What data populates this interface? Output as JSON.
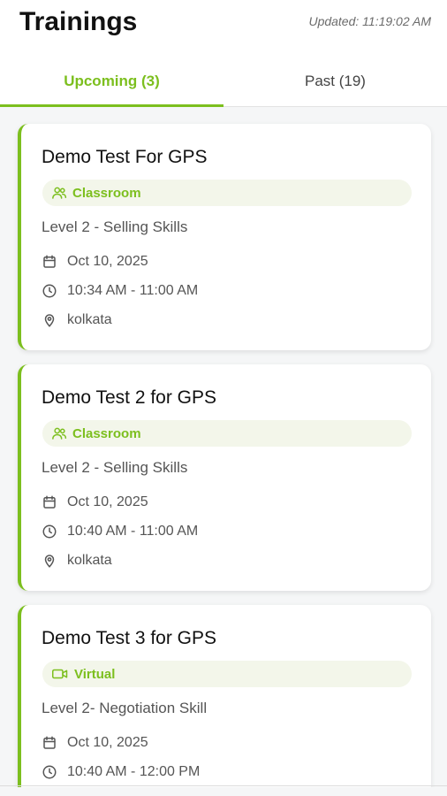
{
  "header": {
    "title": "Trainings",
    "updated": "Updated: 11:19:02 AM"
  },
  "tabs": [
    {
      "label": "Upcoming (3)",
      "active": true
    },
    {
      "label": "Past (19)",
      "active": false
    }
  ],
  "colors": {
    "accent": "#7cbf1e",
    "chip_bg": "#f3f6ea",
    "text_muted": "#555555"
  },
  "trainings": [
    {
      "title": "Demo Test For GPS",
      "type": "Classroom",
      "type_icon": "users-icon",
      "level": "Level 2 - Selling Skills",
      "date": "Oct 10, 2025",
      "time": "10:34 AM - 11:00 AM",
      "location": "kolkata"
    },
    {
      "title": "Demo Test 2 for GPS",
      "type": "Classroom",
      "type_icon": "users-icon",
      "level": "Level 2 - Selling Skills",
      "date": "Oct 10, 2025",
      "time": "10:40 AM - 11:00 AM",
      "location": "kolkata"
    },
    {
      "title": "Demo Test 3 for GPS",
      "type": "Virtual",
      "type_icon": "video-icon",
      "level": "Level 2- Negotiation Skill",
      "date": "Oct 10, 2025",
      "time": "10:40 AM - 12:00 PM",
      "location": ""
    }
  ]
}
